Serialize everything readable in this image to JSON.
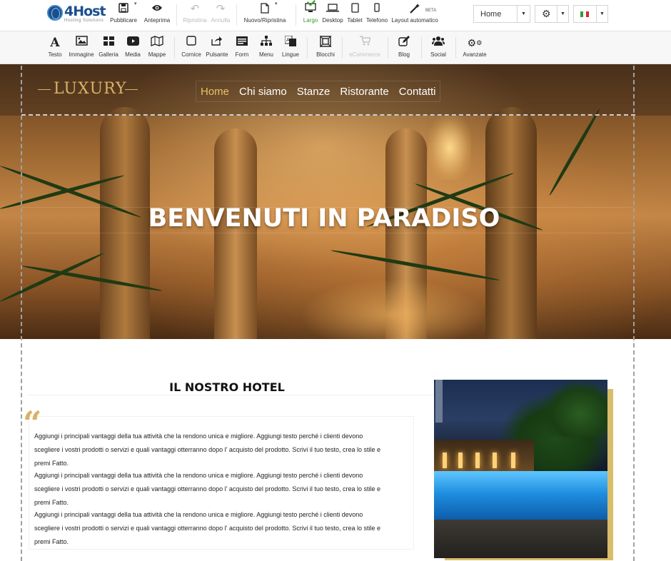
{
  "topbar": {
    "logo": {
      "brand": "4Host",
      "tagline": "Hosting Solutions"
    },
    "buttons": [
      {
        "id": "publish",
        "label": "Pubblicare",
        "icon": "floppy-disk-icon"
      },
      {
        "id": "preview",
        "label": "Anteprima",
        "icon": "eye-icon"
      },
      {
        "id": "undo",
        "label": "Ripristina",
        "icon": "undo-icon",
        "disabled": true
      },
      {
        "id": "redo",
        "label": "Annulla",
        "icon": "redo-icon",
        "disabled": true
      },
      {
        "id": "new",
        "label": "Nuovo/Ripristina",
        "icon": "new-page-icon"
      },
      {
        "id": "wide",
        "label": "Largo",
        "icon": "monitor-icon",
        "active": true
      },
      {
        "id": "desktop",
        "label": "Desktop",
        "icon": "laptop-icon"
      },
      {
        "id": "tablet",
        "label": "Tablet",
        "icon": "tablet-icon"
      },
      {
        "id": "phone",
        "label": "Telefono",
        "icon": "phone-icon"
      },
      {
        "id": "auto",
        "label": "Layout automatico",
        "icon": "magic-wand-icon",
        "badge": "BETA"
      }
    ],
    "page_select": {
      "value": "Home"
    },
    "colors": {
      "active": "#3a9a2a",
      "flag_green": "#2f9e3a",
      "flag_white": "#ffffff",
      "flag_red": "#d42b2b"
    }
  },
  "elements": [
    {
      "id": "text",
      "label": "Testo",
      "icon": "text-icon"
    },
    {
      "id": "image",
      "label": "Immagine",
      "icon": "image-icon"
    },
    {
      "id": "gallery",
      "label": "Galleria",
      "icon": "gallery-icon"
    },
    {
      "id": "media",
      "label": "Media",
      "icon": "video-icon"
    },
    {
      "id": "maps",
      "label": "Mappe",
      "icon": "map-icon"
    },
    {
      "id": "frame",
      "label": "Cornice",
      "icon": "frame-icon"
    },
    {
      "id": "button",
      "label": "Pulsante",
      "icon": "share-button-icon"
    },
    {
      "id": "form",
      "label": "Form",
      "icon": "form-icon"
    },
    {
      "id": "menu",
      "label": "Menu",
      "icon": "sitemap-icon"
    },
    {
      "id": "languages",
      "label": "Lingue",
      "icon": "translate-icon"
    },
    {
      "id": "blocks",
      "label": "Blocchi",
      "icon": "blocks-icon"
    },
    {
      "id": "ecommerce",
      "label": "eCommerce",
      "icon": "cart-icon",
      "disabled": true
    },
    {
      "id": "blog",
      "label": "Blog",
      "icon": "edit-icon"
    },
    {
      "id": "social",
      "label": "Social",
      "icon": "users-icon"
    },
    {
      "id": "advanced",
      "label": "Avanzate",
      "icon": "cogs-icon"
    }
  ],
  "site": {
    "logo_text": "LUXURY",
    "nav": [
      {
        "label": "Home",
        "active": true
      },
      {
        "label": "Chi siamo"
      },
      {
        "label": "Stanze"
      },
      {
        "label": "Ristorante"
      },
      {
        "label": "Contatti"
      }
    ],
    "hero_title": "BENVENUTI IN PARADISO",
    "section_title": "IL NOSTRO HOTEL",
    "quote_mark": "“",
    "paragraphs": [
      [
        "Aggiungi i principali vantaggi della tua attività che la rendono unica e migliore. Aggiungi testo perché i clienti devono",
        "scegliere i vostri prodotti o servizi e quali vantaggi otterranno dopo l' acquisto del prodotto. Scrivi il tuo testo, crea lo stile e",
        "premi Fatto."
      ],
      [
        "Aggiungi i principali vantaggi della tua attività che la rendono unica e migliore. Aggiungi testo perché i clienti devono",
        "scegliere i vostri prodotti o servizi e quali vantaggi otterranno dopo l' acquisto del prodotto. Scrivi il tuo testo, crea lo stile e",
        "premi Fatto."
      ],
      [
        "Aggiungi i principali vantaggi della tua attività che la rendono unica e migliore. Aggiungi testo perché i clienti devono",
        "scegliere i vostri prodotti o servizi e quali vantaggi otterranno dopo l' acquisto del prodotto. Scrivi il tuo testo, crea lo stile e",
        "premi Fatto."
      ]
    ],
    "colors": {
      "gold": "#d8b266",
      "nav_active": "#e8c36a"
    }
  }
}
